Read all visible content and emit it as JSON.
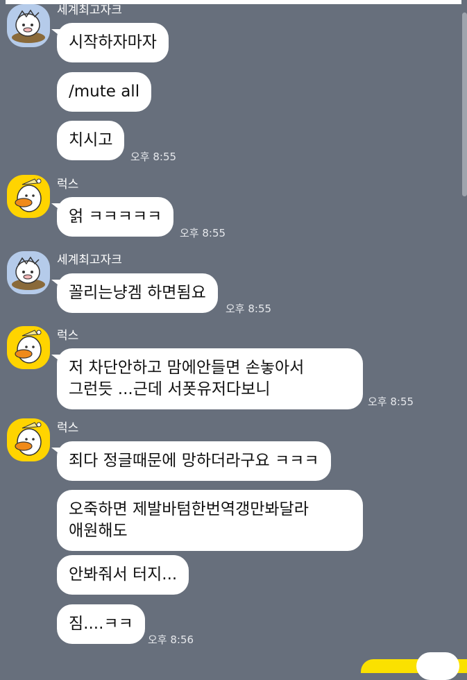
{
  "chat": {
    "messages": [
      {
        "sender": "세계최고자크",
        "avatar": "jay-g-avatar",
        "texts": [
          "시작하자마자",
          "/mute all",
          "치시고"
        ],
        "time": "오후 8:55"
      },
      {
        "sender": "럭스",
        "avatar": "tube-avatar",
        "texts": [
          "얽 ㅋㅋㅋㅋㅋ"
        ],
        "time": "오후 8:55"
      },
      {
        "sender": "세계최고자크",
        "avatar": "jay-g-avatar",
        "texts": [
          "꼴리는냥겜 하면됨요"
        ],
        "time": "오후 8:55"
      },
      {
        "sender": "럭스",
        "avatar": "tube-avatar",
        "texts": [
          "저 차단안하고 맘에안들면 손놓아서\n그런듯 ...근데 서폿유저다보니"
        ],
        "time": "오후 8:55"
      },
      {
        "sender": "럭스",
        "avatar": "tube-avatar",
        "texts": [
          "죄다 정글때문에 망하더라구요 ㅋㅋㅋ",
          "오죽하면 제발바텀한번역갱만봐달라\n애원해도",
          "안봐줘서 터지...",
          "짐....ㅋㅋ"
        ],
        "time": "오후 8:56"
      }
    ]
  },
  "colors": {
    "background": "#676f7c",
    "bubble": "#ffffff",
    "my_bubble": "#fae100",
    "jay_g_avatar_bg": "#b5cbea",
    "tube_avatar_bg": "#ffd400"
  }
}
